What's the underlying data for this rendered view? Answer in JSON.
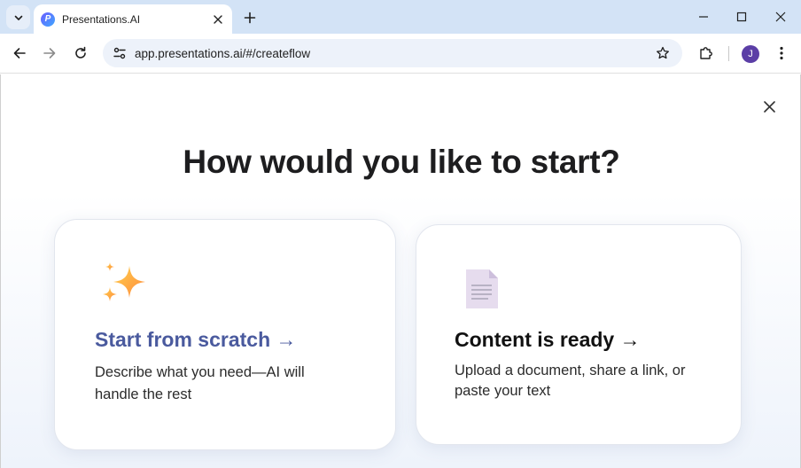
{
  "browser": {
    "tab": {
      "title": "Presentations.AI",
      "favicon_letter": "P"
    },
    "url": "app.presentations.ai/#/createflow",
    "profile_initial": "J"
  },
  "page": {
    "title": "How would you like to start?",
    "cards": [
      {
        "heading": "Start from scratch →",
        "description": "Describe what you need—AI will handle the rest",
        "icon": "sparkles-icon",
        "heading_color": "#4a5a9e"
      },
      {
        "heading": "Content is ready →",
        "description": "Upload a document, share a link, or paste your text",
        "icon": "document-icon",
        "heading_color": "#111111"
      }
    ]
  },
  "colors": {
    "tabstrip": "#d3e3f6",
    "omnibox": "#edf2fa",
    "avatar": "#5b3ea6"
  }
}
